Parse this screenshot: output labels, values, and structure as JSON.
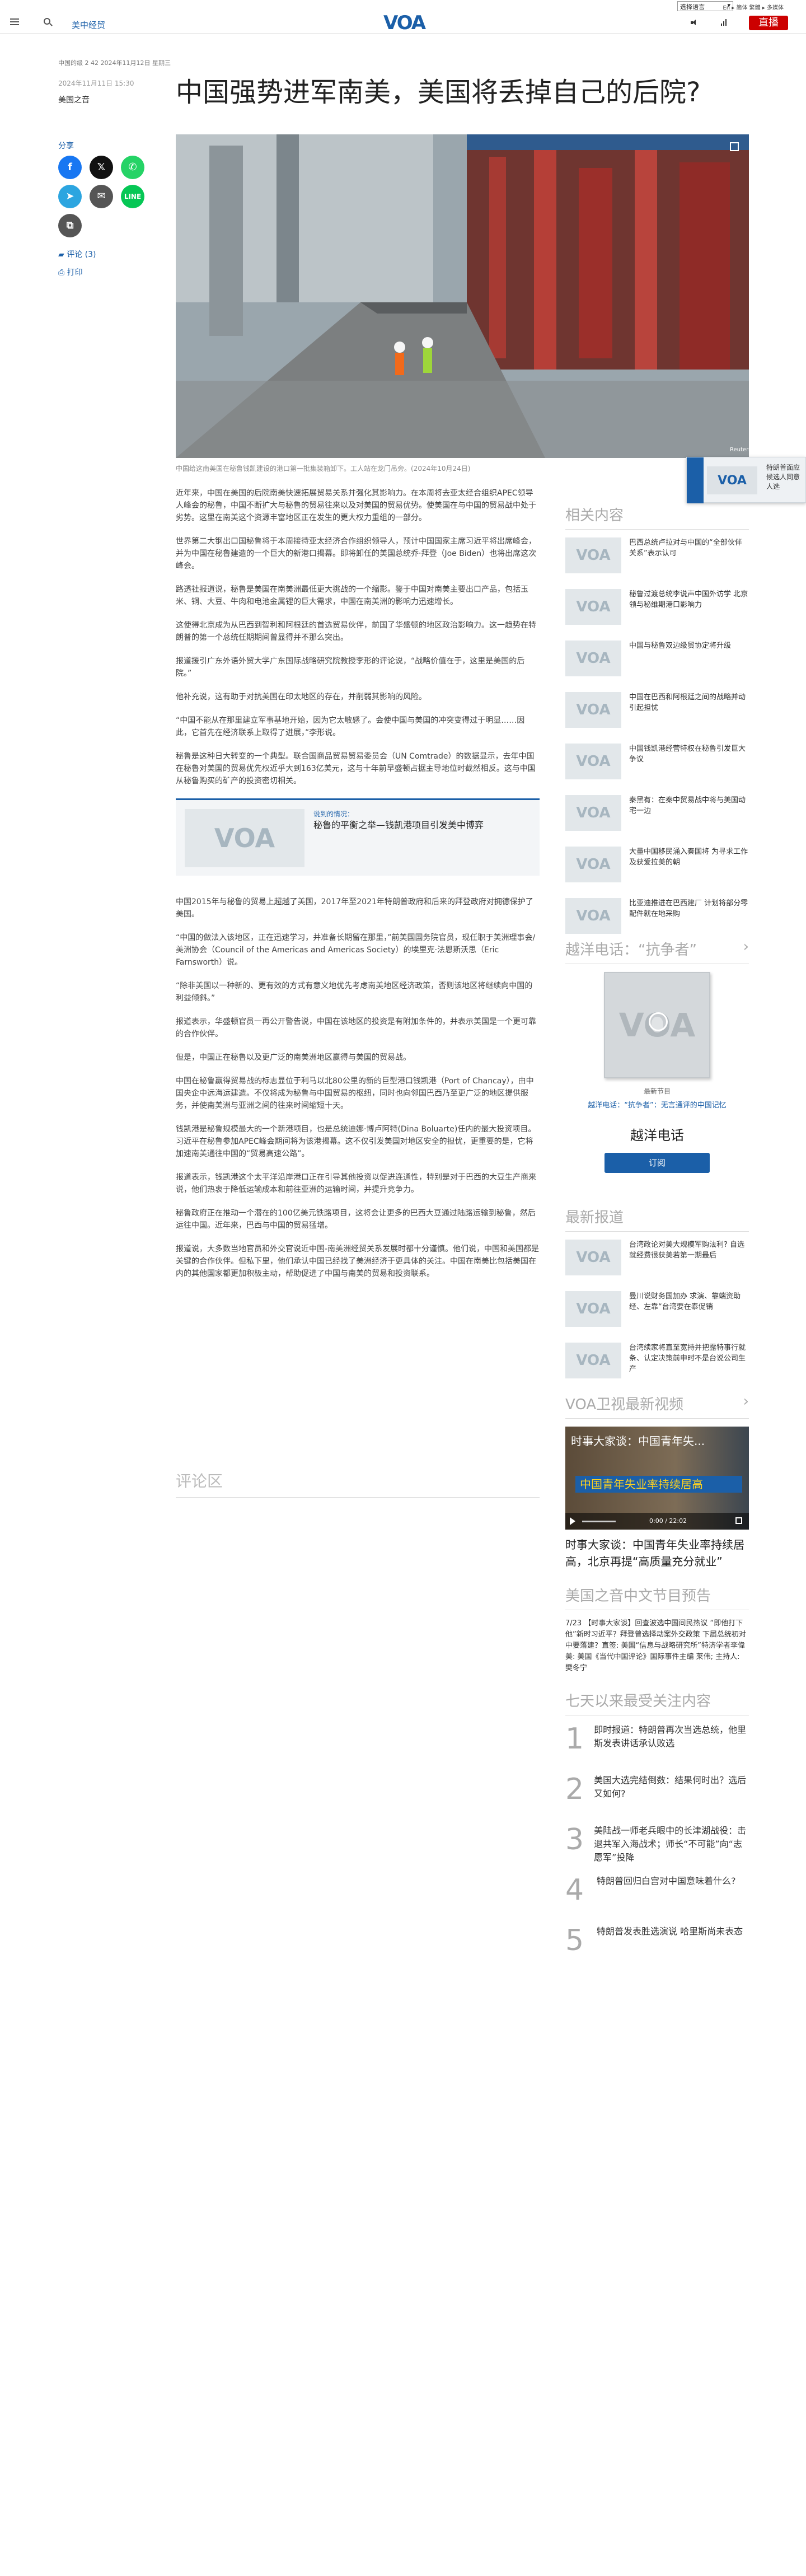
{
  "topbar": {
    "language_select": "选择语言",
    "links": "En ▸ 简体 繁體 ▸ 多媒体"
  },
  "header": {
    "section": "美中经贸",
    "logo": "VOA",
    "live_label": "直播"
  },
  "article": {
    "meta_line": "中国的级 2 42 2024年11月12日 星期三",
    "date": "2024年11月11日 15:30",
    "author": "美国之音",
    "title": "中国强势进军南美，美国将丢掉自己的后院?",
    "share_label": "分享",
    "comments_label": "评论 (3)",
    "print_label": "打印",
    "caption": "中国给这南美国在秘鲁钱凯建设的港口第一批集装箱卸下。工人站在龙门吊旁。(2024年10月24日)",
    "paragraphs": [
      "近年来，中国在美国的后院南美快速拓展贸易关系并强化其影响力。在本周将去亚太经合组织APEC领导人峰会的秘鲁，中国不断扩大与秘鲁的贸易往来以及对美国的贸易优势。使美国在与中国的贸易战中处于劣势。这里在南美这个资源丰富地区正在发生的更大权力重组的一部分。",
      "世界第二大钢出口国秘鲁将于本周接待亚太经济合作组织领导人，预计中国国家主席习近平将出席峰会，并为中国在秘鲁建造的一个巨大的新港口揭幕。即将卸任的美国总统乔·拜登（Joe Biden）也将出席这次峰会。",
      "路透社报道说，秘鲁是美国在南美洲最低更大挑战的一个缩影。鉴于中国对南美主要出口产品，包括玉米、铜、大豆、牛肉和电池金属锂的巨大需求，中国在南美洲的影响力迅速增长。",
      "这使得北京成为从巴西到智利和阿根廷的首选贸易伙伴，前国了华盛顿的地区政治影响力。这一趋势在特朗普的第一个总统任期期间曾显得并不那么突出。",
      "报道援引广东外语外贸大学广东国际战略研究院教授李形的评论说，“战略价值在于，这里是美国的后院。”",
      "他补充说，这有助于对抗美国在印太地区的存在，并削弱其影响的风险。",
      "“中国不能从在那里建立军事基地开始，因为它太敏感了。会使中国与美国的冲突变得过于明显……因此，它首先在经济联系上取得了进展，”李形说。",
      "秘鲁是这种日大转变的一个典型。联合国商品贸易贸易委员会（UN Comtrade）的数据显示，去年中国在秘鲁对美国的贸易优先权近乎大到163亿美元，这与十年前早盛顿占据主导地位时截然相反。这与中国从秘鲁购买的矿产的投资密切相关。",
      "中国2015年与秘鲁的贸易上超越了美国，2017年至2021年特朗普政府和后来的拜登政府对拥德保护了美国。",
      "“中国的做法入该地区，正在迅速学习，并准备长期留在那里，”前美国国务院官员，现任职于美洲理事会/美洲协会（Council of the Americas and Americas Society）的埃里克·法恩斯沃思（Eric Farnsworth）说。",
      "“除非美国以一种新的、更有效的方式有意义地优先考虑南美地区经济政策，否则该地区将继续向中国的利益倾斜。”",
      "报道表示，华盛顿官员一再公开警告说，中国在该地区的投资是有附加条件的，并表示美国是一个更可靠的合作伙伴。",
      "但是，中国正在秘鲁以及更广泛的南美洲地区赢得与美国的贸易战。",
      "中国在秘鲁赢得贸易战的标志显位于利马以北80公里的新的巨型港口钱凯港（Port of Chancay），由中国央企中远海运建造。不仅将成为秘鲁与中国贸易的枢纽，同时也向邻国巴西乃至更广泛的地区提供服务，并使南美洲与亚洲之间的往来时间缩短十天。",
      "钱凯港是秘鲁规模最大的一个新港项目，也是总统迪娜·博卢阿特(Dina Boluarte)任内的最大投资项目。习近平在秘鲁参加APEC峰会期间将为该港揭幕。这不仅引发美国对地区安全的担忧，更重要的是，它将加速南美通往中国的“贸易高速公路”。",
      "报道表示，钱凯港这个太平洋沿岸港口正在引导其他投资以促进连通性，特别是对于巴西的大豆生产商来说，他们热衷于降低运输成本和前往亚洲的运输时间，并提升竞争力。",
      "秘鲁政府正在推动一个潜在的100亿美元铁路项目，这将会让更多的巴西大豆通过陆路运输到秘鲁，然后运往中国。近年来，巴西与中国的贸易猛增。",
      "报道说，大多数当地官员和外交官说近中国-南美洲经贸关系发展时都十分谨慎。他们说，中国和美国都是关键的合作伙伴。但私下里，他们承认中国已经找了美洲经济于更具体的关注。中国在南美比包括美国在内的其他国家都更加积极主动，帮助促进了中国与南美的贸易和投资联系。"
    ],
    "read_also": {
      "label": "说到的情况：",
      "title": "秘鲁的平衡之举—钱凯港项目引发美中博弈"
    },
    "comments_section": "评论区"
  },
  "popup": {
    "text": "特朗普面应候选人同意人选"
  },
  "sidebar": {
    "related_heading": "相关内容",
    "related": [
      "巴西总统卢拉对与中国的“全部伙伴关系”表示认可",
      "秘鲁过渡总统李说声中国外访学 北京领与秘维期港口影响力",
      "中国与秘鲁双边级贸协定将升级",
      "中国在巴西和阿根廷之间的战略并动引起担忧",
      "中国钱凯港经营特权在秘鲁引发巨大争议",
      "秦黑有：在秦中贸易战中将与美国动宅一边",
      "大量中国移民涌入秦国将 为寻求工作及获爱拉美的朝",
      "比亚迪推进在巴西建厂 计划将部分零配件就在地采购"
    ],
    "podcast_heading": "越洋电话：“抗争者”",
    "podcast_latest": "最新节目",
    "podcast_link": "越洋电话：“抗争者”：无言通评的中国记忆",
    "podcast_title": "越洋电话",
    "subscribe_label": "订阅",
    "latest_heading": "最新报道",
    "latest": [
      "台湾政论对美大规模军购法利? 自选就经费很获美若第一期最后",
      "曼川说财务国加办 求演、靠端资助经、左靠“台湾要在泰促销",
      "台湾续家将直至宽持并把露特事行就条、认定决策前申时不是台说公司生产"
    ],
    "video_heading": "VOA卫视最新视频",
    "video_overlay": "时事大家谈：中国青年失...",
    "video_banner": "中国青年失业率持续居高",
    "video_time": "0:00 / 22:02",
    "video_title": "时事大家谈：中国青年失业率持续居高，北京再提“高质量充分就业”",
    "program_heading": "美国之音中文节目预告",
    "program_text": "7/23 【时事大家谈】回查波选中国间民热议 “即他打下他”新时习近平？拜登曾选择动案外交政策 下届总统初对中要落建？直签: 美国“信息与战略研究所”特济学者李偉美: 美国《当代中国评论》国际事件主编 莱伟; 主持人: 樊冬宁",
    "most_heading": "七天以来最受关注内容",
    "most": [
      {
        "num": "1",
        "text": "即时报道：特朗普再次当选总统，他里斯发表讲话承认败选"
      },
      {
        "num": "2",
        "text": "美国大选完结倒数：结果何时出？选后又如何?"
      },
      {
        "num": "3",
        "text": "美陆战一师老兵眼中的长津湖战役：击退共军入海战术；师长“不可能”向“志愿军”投降"
      },
      {
        "num": "4",
        "text": "特朗普回归白宫对中国意味着什么?"
      },
      {
        "num": "5",
        "text": "特朗普发表胜选演说 哈里斯尚未表态"
      }
    ]
  },
  "colors": {
    "brand_blue": "#1b5fa8",
    "live_red": "#cc0000"
  }
}
